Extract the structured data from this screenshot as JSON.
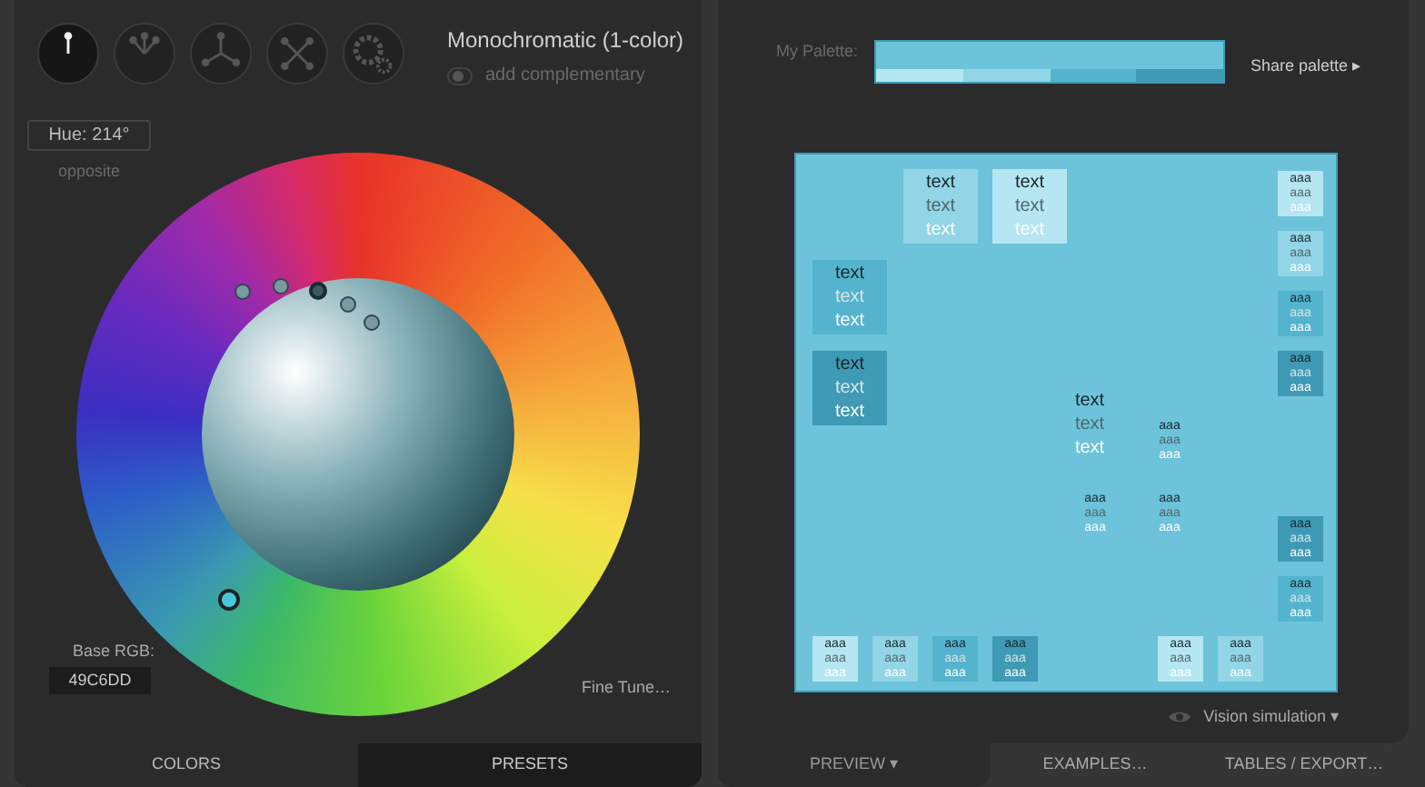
{
  "schemes": [
    {
      "kind": "mono",
      "selected": true
    },
    {
      "kind": "adjacent",
      "selected": false
    },
    {
      "kind": "triad",
      "selected": false
    },
    {
      "kind": "tetrad",
      "selected": false
    },
    {
      "kind": "free",
      "selected": false
    }
  ],
  "scheme_title": "Monochromatic (1-color)",
  "complementary": {
    "label": "add complementary",
    "on": false
  },
  "hue": "Hue: 214°",
  "opposite": "opposite",
  "base_rgb": {
    "label": "Base RGB:",
    "value": "49C6DD"
  },
  "fine_tune": "Fine Tune…",
  "left_tabs": [
    {
      "label": "COLORS",
      "selected": true
    },
    {
      "label": "PRESETS",
      "selected": false
    }
  ],
  "palette": {
    "label": "My Palette:",
    "main": {
      "color": "#6cc3da"
    },
    "shades": [
      {
        "color": "#b6e6f2"
      },
      {
        "color": "#92d5e6"
      },
      {
        "color": "#54b4cd"
      },
      {
        "color": "#3f9ab5"
      }
    ]
  },
  "share": "Share palette ▸",
  "preview": {
    "swatches": [
      {
        "color": "#92d5e6",
        "texts": [
          "text",
          "text",
          "text"
        ]
      },
      {
        "color": "#b6e6f2",
        "texts": [
          "text",
          "text",
          "text"
        ]
      },
      {
        "color": "#b6e6f2",
        "texts": [
          "aaa",
          "aaa",
          "aaa"
        ]
      },
      {
        "color": "#92d5e6",
        "texts": [
          "aaa",
          "aaa",
          "aaa"
        ]
      },
      {
        "color": "#54b4cd",
        "texts": [
          "text",
          "text",
          "text"
        ]
      },
      {
        "color": "#54b4cd",
        "texts": [
          "aaa",
          "aaa",
          "aaa"
        ]
      },
      {
        "color": "#3f9ab5",
        "texts": [
          "text",
          "text",
          "text"
        ]
      },
      {
        "color": "#3f9ab5",
        "texts": [
          "aaa",
          "aaa",
          "aaa"
        ]
      },
      {
        "color": "#6cc3da",
        "texts": [
          "text",
          "text",
          "text"
        ]
      },
      {
        "color": "#6cc3da",
        "texts": [
          "aaa",
          "aaa",
          "aaa"
        ]
      },
      {
        "color": "#6cc3da",
        "texts": [
          "aaa",
          "aaa",
          "aaa"
        ]
      },
      {
        "color": "#6cc3da",
        "texts": [
          "aaa",
          "aaa",
          "aaa"
        ]
      },
      {
        "color": "#3f9ab5",
        "texts": [
          "aaa",
          "aaa",
          "aaa"
        ]
      },
      {
        "color": "#54b4cd",
        "texts": [
          "aaa",
          "aaa",
          "aaa"
        ]
      },
      {
        "color": "#b6e6f2",
        "texts": [
          "aaa",
          "aaa",
          "aaa"
        ]
      },
      {
        "color": "#92d5e6",
        "texts": [
          "aaa",
          "aaa",
          "aaa"
        ]
      },
      {
        "color": "#54b4cd",
        "texts": [
          "aaa",
          "aaa",
          "aaa"
        ]
      },
      {
        "color": "#3f9ab5",
        "texts": [
          "aaa",
          "aaa",
          "aaa"
        ]
      },
      {
        "color": "#b6e6f2",
        "texts": [
          "aaa",
          "aaa",
          "aaa"
        ]
      },
      {
        "color": "#92d5e6",
        "texts": [
          "aaa",
          "aaa",
          "aaa"
        ]
      }
    ]
  },
  "vision": "Vision simulation ▾",
  "right_tabs": [
    {
      "label": "PREVIEW ▾",
      "selected": true
    },
    {
      "label": "EXAMPLES…",
      "selected": false
    },
    {
      "label": "TABLES / EXPORT…",
      "selected": false
    }
  ]
}
